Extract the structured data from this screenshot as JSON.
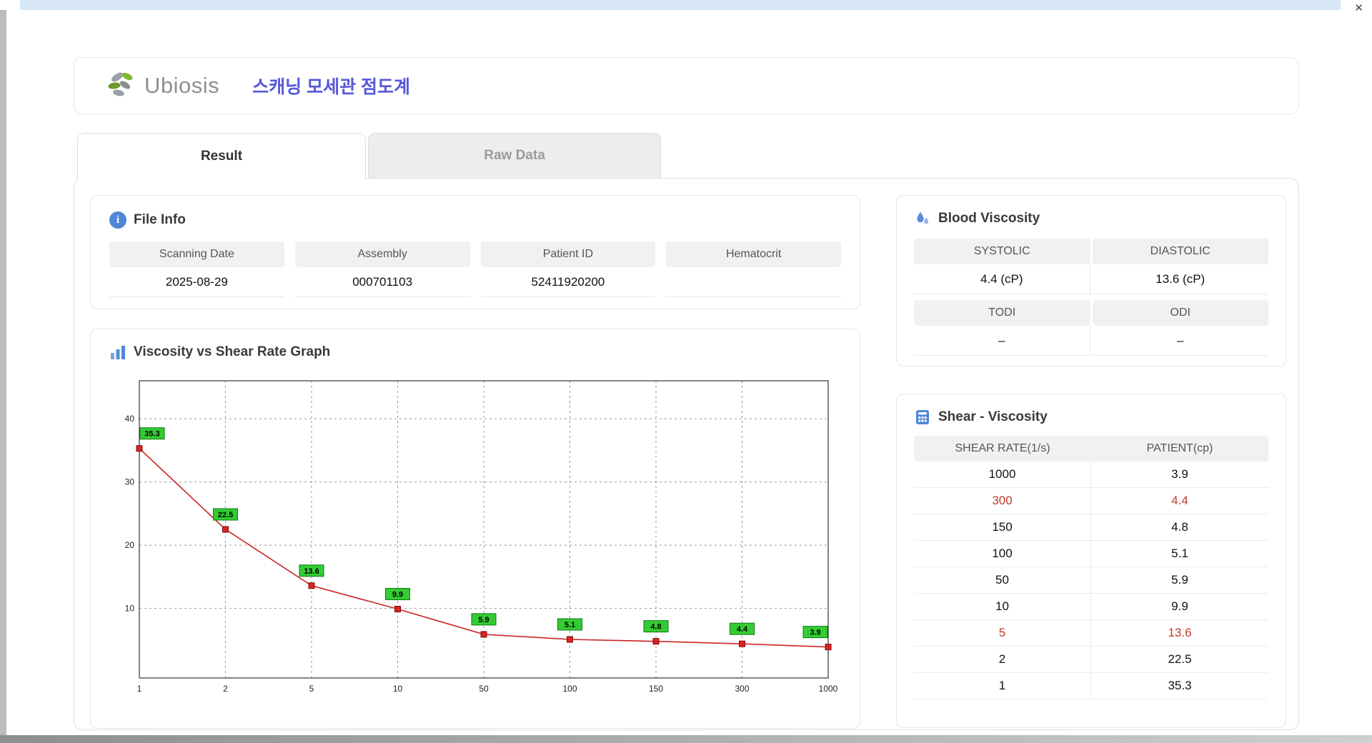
{
  "window": {
    "close_glyph": "✕"
  },
  "header": {
    "logo_text": "Ubiosis",
    "title": "스캐닝 모세관 점도계"
  },
  "tabs": {
    "result": "Result",
    "raw": "Raw Data"
  },
  "file_info": {
    "title": "File Info",
    "fields": [
      {
        "label": "Scanning Date",
        "value": "2025-08-29"
      },
      {
        "label": "Assembly",
        "value": "000701103"
      },
      {
        "label": "Patient ID",
        "value": "52411920200"
      },
      {
        "label": "Hematocrit",
        "value": ""
      }
    ]
  },
  "blood_viscosity": {
    "title": "Blood Viscosity",
    "row1": [
      {
        "label": "SYSTOLIC",
        "value": "4.4 (cP)"
      },
      {
        "label": "DIASTOLIC",
        "value": "13.6 (cP)"
      }
    ],
    "row2": [
      {
        "label": "TODI",
        "value": "–"
      },
      {
        "label": "ODI",
        "value": "–"
      }
    ]
  },
  "graph": {
    "title": "Viscosity vs Shear Rate Graph"
  },
  "chart_data": {
    "type": "line",
    "title": "Viscosity vs Shear Rate Graph",
    "x": [
      1,
      2,
      5,
      10,
      50,
      100,
      150,
      300,
      1000
    ],
    "values": [
      35.3,
      22.5,
      13.6,
      9.9,
      5.9,
      5.1,
      4.8,
      4.4,
      3.9
    ],
    "x_scale": "categorical-equal-spacing",
    "yticks": [
      10,
      20,
      30,
      40
    ],
    "ylim": [
      -1,
      46
    ],
    "grid": "dashed",
    "line_color": "#cc2222",
    "marker": "square",
    "marker_color": "#dd2222",
    "marker_border": "#7a0f0f",
    "point_label_bg": "#33cc33",
    "point_label_border": "#117a11",
    "point_label_text": "#000000"
  },
  "shear_table": {
    "title": "Shear - Viscosity",
    "columns": [
      "SHEAR RATE(1/s)",
      "PATIENT(cp)"
    ],
    "rows": [
      {
        "shear": "1000",
        "patient": "3.9",
        "highlight": false
      },
      {
        "shear": "300",
        "patient": "4.4",
        "highlight": true
      },
      {
        "shear": "150",
        "patient": "4.8",
        "highlight": false
      },
      {
        "shear": "100",
        "patient": "5.1",
        "highlight": false
      },
      {
        "shear": "50",
        "patient": "5.9",
        "highlight": false
      },
      {
        "shear": "10",
        "patient": "9.9",
        "highlight": false
      },
      {
        "shear": "5",
        "patient": "13.6",
        "highlight": true
      },
      {
        "shear": "2",
        "patient": "22.5",
        "highlight": false
      },
      {
        "shear": "1",
        "patient": "35.3",
        "highlight": false
      }
    ],
    "highlight_color": "#c0392b"
  },
  "colors": {
    "accent_blue": "#4f87d7",
    "title_purple": "#5558d9",
    "titlebar_blue": "#d7e7f6",
    "logo_green": "#80b832",
    "logo_gray": "#9aa0a6"
  }
}
